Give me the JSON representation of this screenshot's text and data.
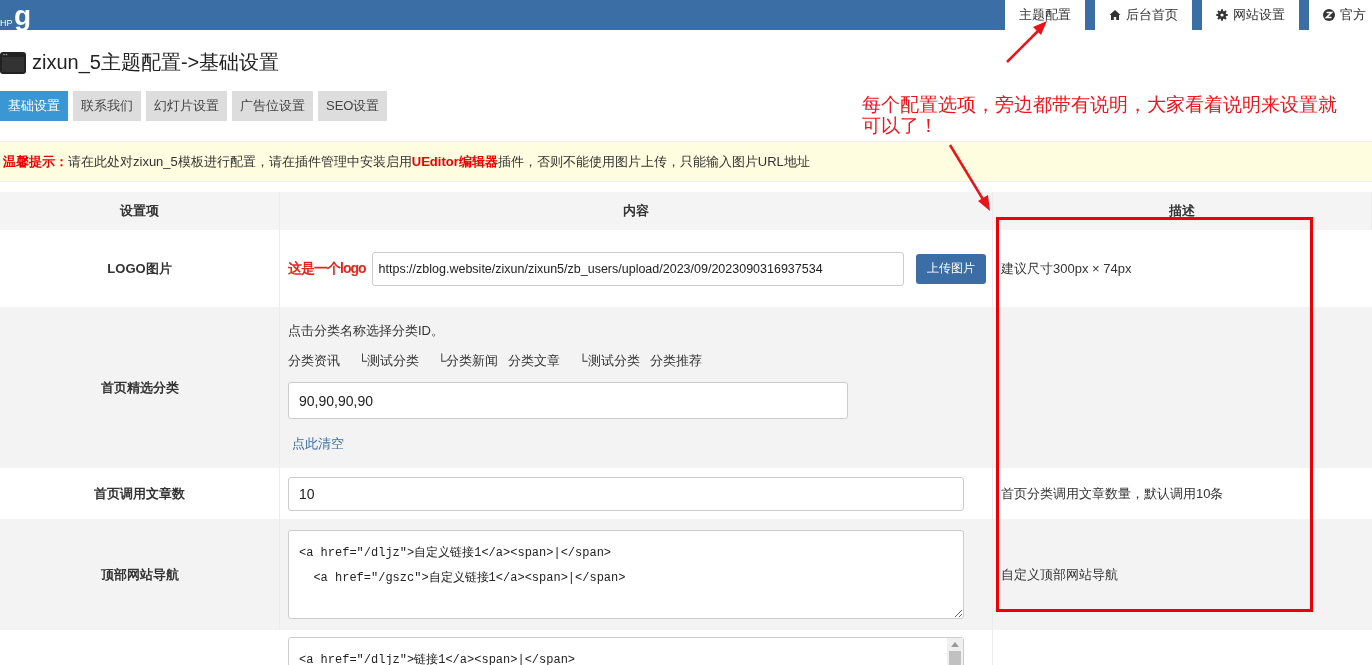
{
  "header": {
    "logo_main": "g",
    "logo_sub": "HP",
    "nav": [
      {
        "label": "主题配置",
        "kind": "plain"
      },
      {
        "label": "后台首页",
        "kind": "home"
      },
      {
        "label": "网站设置",
        "kind": "gear"
      },
      {
        "label": "官方",
        "kind": "z"
      }
    ]
  },
  "page_title": "zixun_5主题配置->基础设置",
  "tabs": [
    {
      "label": "基础设置",
      "selected": true
    },
    {
      "label": "联系我们",
      "selected": false
    },
    {
      "label": "幻灯片设置",
      "selected": false
    },
    {
      "label": "广告位设置",
      "selected": false
    },
    {
      "label": "SEO设置",
      "selected": false
    }
  ],
  "notice": {
    "label": "温馨提示：",
    "text": "请在此处对zixun_5模板进行配置，请在插件管理中安装启用**UEditor编辑器**插件，否则不能使用图片上传，只能输入图片URL地址"
  },
  "table": {
    "columns": [
      "设置项",
      "内容",
      "描述"
    ],
    "rows": [
      {
        "kind": "image",
        "label": "LOGO图片",
        "logo_text": "这是一个logo",
        "value": "https://zblog.website/zixun/zixun5/zb_users/upload/2023/09/2023090316937534",
        "button": "上传图片",
        "description": "建议尺寸300px × 74px"
      },
      {
        "kind": "category",
        "label": "首页精选分类",
        "hint": "点击分类名称选择分类ID。",
        "categories": [
          {
            "name": "分类资讯",
            "children": [
              {
                "name": "└测试分类"
              },
              {
                "name": "└分类新闻"
              }
            ]
          },
          {
            "name": "分类文章",
            "children": [
              {
                "name": "└测试分类"
              }
            ]
          },
          {
            "name": "分类推荐"
          }
        ],
        "value": "90,90,90,90",
        "link": "点此清空",
        "description": ""
      },
      {
        "kind": "input",
        "label": "首页调用文章数",
        "value": "10",
        "description": "首页分类调用文章数量，默认调用10条"
      },
      {
        "kind": "textarea",
        "label": "顶部网站导航",
        "value": "<a href=\"/dljz\">自定义链接1</a><span>|</span>\n  <a href=\"/gszc\">自定义链接1</a><span>|</span>",
        "scrollbar": false,
        "description": "自定义顶部网站导航"
      },
      {
        "kind": "textarea",
        "label": "",
        "value": "<a href=\"/dljz\">链接1</a><span>|</span>",
        "scrollbar": true,
        "description": ""
      }
    ]
  },
  "annotation": {
    "text": "每个配置选项，旁边都带有说明，大家看着说明来设置就可以了！"
  }
}
